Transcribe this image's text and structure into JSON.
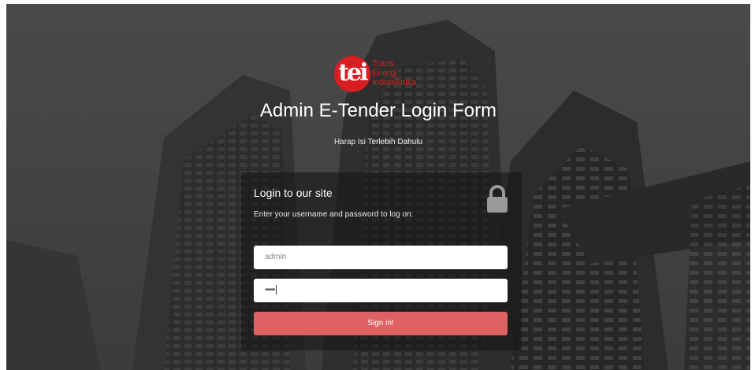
{
  "brand": {
    "logo_mark": "tei",
    "logo_line1": "Trans",
    "logo_line2": "Energi",
    "logo_line3": "Indoteknika",
    "color": "#d81e23"
  },
  "header": {
    "title": "Admin E-Tender Login Form",
    "subtitle": "Harap Isi Terlebih Dahulu"
  },
  "login": {
    "heading": "Login to our site",
    "description": "Enter your username and password to log on:",
    "lock_icon": "lock-icon",
    "username_value": "admin",
    "password_mask": "•••••",
    "submit_label": "Sign in!",
    "button_color": "#de6262"
  }
}
